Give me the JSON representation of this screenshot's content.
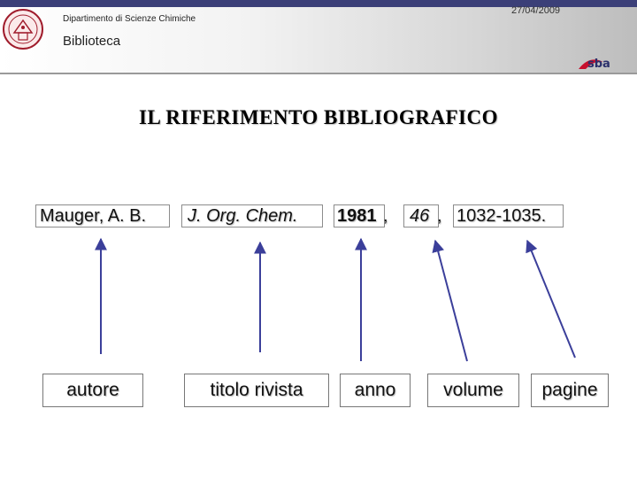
{
  "header": {
    "department": "Dipartimento di Scienze Chimiche",
    "section": "Biblioteca",
    "date": "27/04/2009",
    "logo_icon": "university-seal-icon",
    "brand_logo_icon": "sba-logo-icon"
  },
  "slide": {
    "title": "IL RIFERIMENTO BIBLIOGRAFICO",
    "citation": {
      "author": "Mauger, A. B.",
      "journal": "J. Org. Chem.",
      "year": "1981",
      "volume": "46",
      "pages": "1032-1035.",
      "separator": ","
    },
    "labels": {
      "author": "autore",
      "journal": "titolo rivista",
      "year": "anno",
      "volume": "volume",
      "pages": "pagine"
    }
  },
  "colors": {
    "arrow": "#3b3f9a",
    "top_bar": "#3b3f78",
    "brand_red": "#c8102e"
  }
}
